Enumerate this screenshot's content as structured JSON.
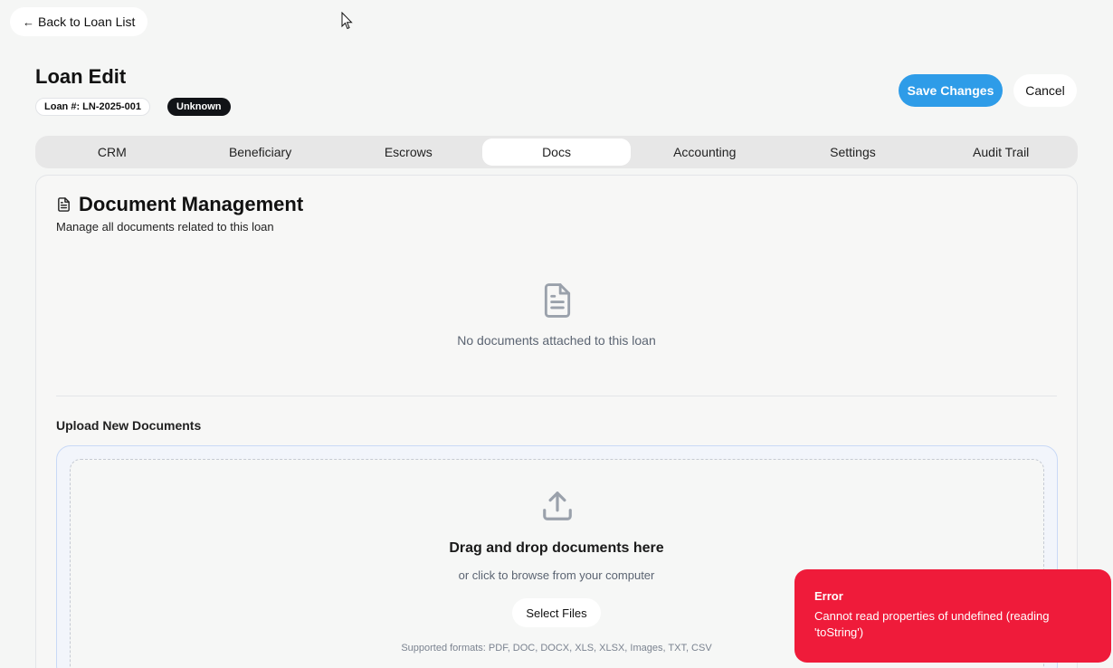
{
  "nav": {
    "back_label": "Back to Loan List"
  },
  "header": {
    "title": "Loan Edit",
    "loan_chip": "Loan #: LN-2025-001",
    "status": "Unknown",
    "save_label": "Save Changes",
    "cancel_label": "Cancel"
  },
  "tabs": [
    {
      "label": "CRM"
    },
    {
      "label": "Beneficiary"
    },
    {
      "label": "Escrows"
    },
    {
      "label": "Docs",
      "active": true
    },
    {
      "label": "Accounting"
    },
    {
      "label": "Settings"
    },
    {
      "label": "Audit Trail"
    }
  ],
  "documents": {
    "title": "Document Management",
    "subtitle": "Manage all documents related to this loan",
    "empty_text": "No documents attached to this loan"
  },
  "upload": {
    "title": "Upload New Documents",
    "drag_title": "Drag and drop documents here",
    "drag_sub": "or click to browse from your computer",
    "select_label": "Select Files",
    "formats": "Supported formats: PDF, DOC, DOCX, XLS, XLSX, Images, TXT, CSV"
  },
  "toast": {
    "title": "Error",
    "message": "Cannot read properties of undefined (reading 'toString')"
  },
  "colors": {
    "primary": "#2e9ce8",
    "error": "#ef1b3a",
    "status_chip": "#111317"
  }
}
